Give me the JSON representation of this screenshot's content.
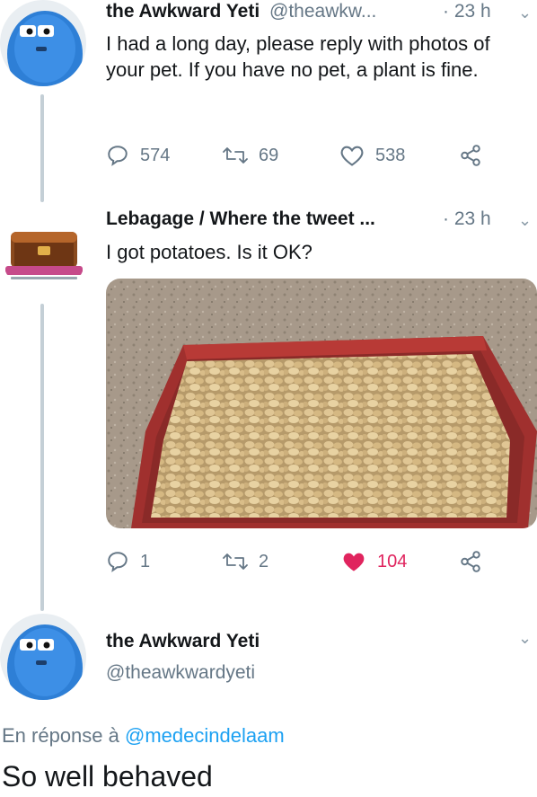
{
  "tweet1": {
    "display_name": "the Awkward Yeti",
    "handle": "@theawkw...",
    "time": "· 23 h",
    "text": "I had a long day, please reply with photos of your pet. If you have no pet, a plant is fine.",
    "replies": "574",
    "retweets": "69",
    "likes": "538"
  },
  "tweet2": {
    "display_name": "Lebagage / Where the tweet ...",
    "time": "· 23 h",
    "text": "I got potatoes. Is it OK?",
    "replies": "1",
    "retweets": "2",
    "likes": "104"
  },
  "tweet3": {
    "display_name": "the Awkward Yeti",
    "handle": "@theawkwardyeti",
    "reply_prefix": "En réponse à",
    "reply_to": "@medecindelaam",
    "text": "So well behaved"
  },
  "colors": {
    "like_active": "#e0245e",
    "link": "#1da1f2",
    "muted": "#657786"
  }
}
